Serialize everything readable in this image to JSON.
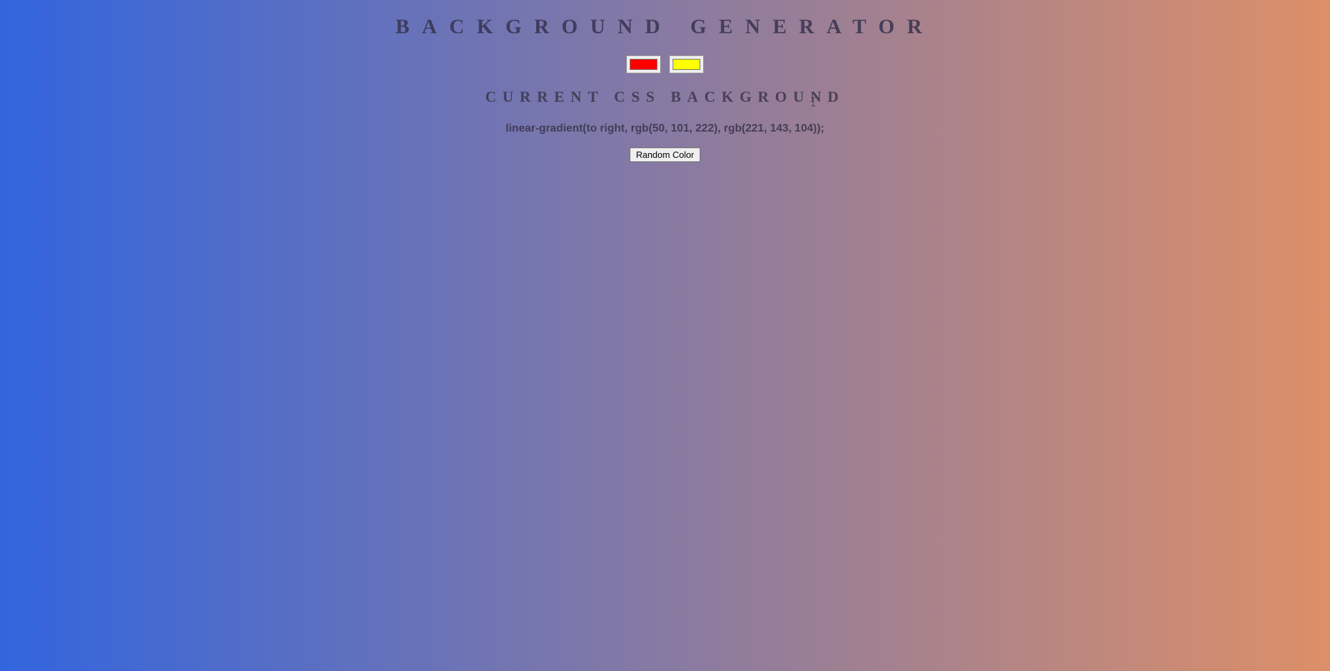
{
  "page": {
    "title": "Background Generator",
    "subtitle": "Current CSS Background",
    "css_text": "linear-gradient(to right, rgb(50, 101, 222), rgb(221, 143, 104));",
    "random_button_label": "Random Color"
  },
  "colors": {
    "gradient_start": "#3265de",
    "gradient_end": "#dd8f68",
    "color1_value": "#ff0000",
    "color2_value": "#ffff00"
  },
  "icons": {
    "cursor": "text-cursor-icon"
  }
}
